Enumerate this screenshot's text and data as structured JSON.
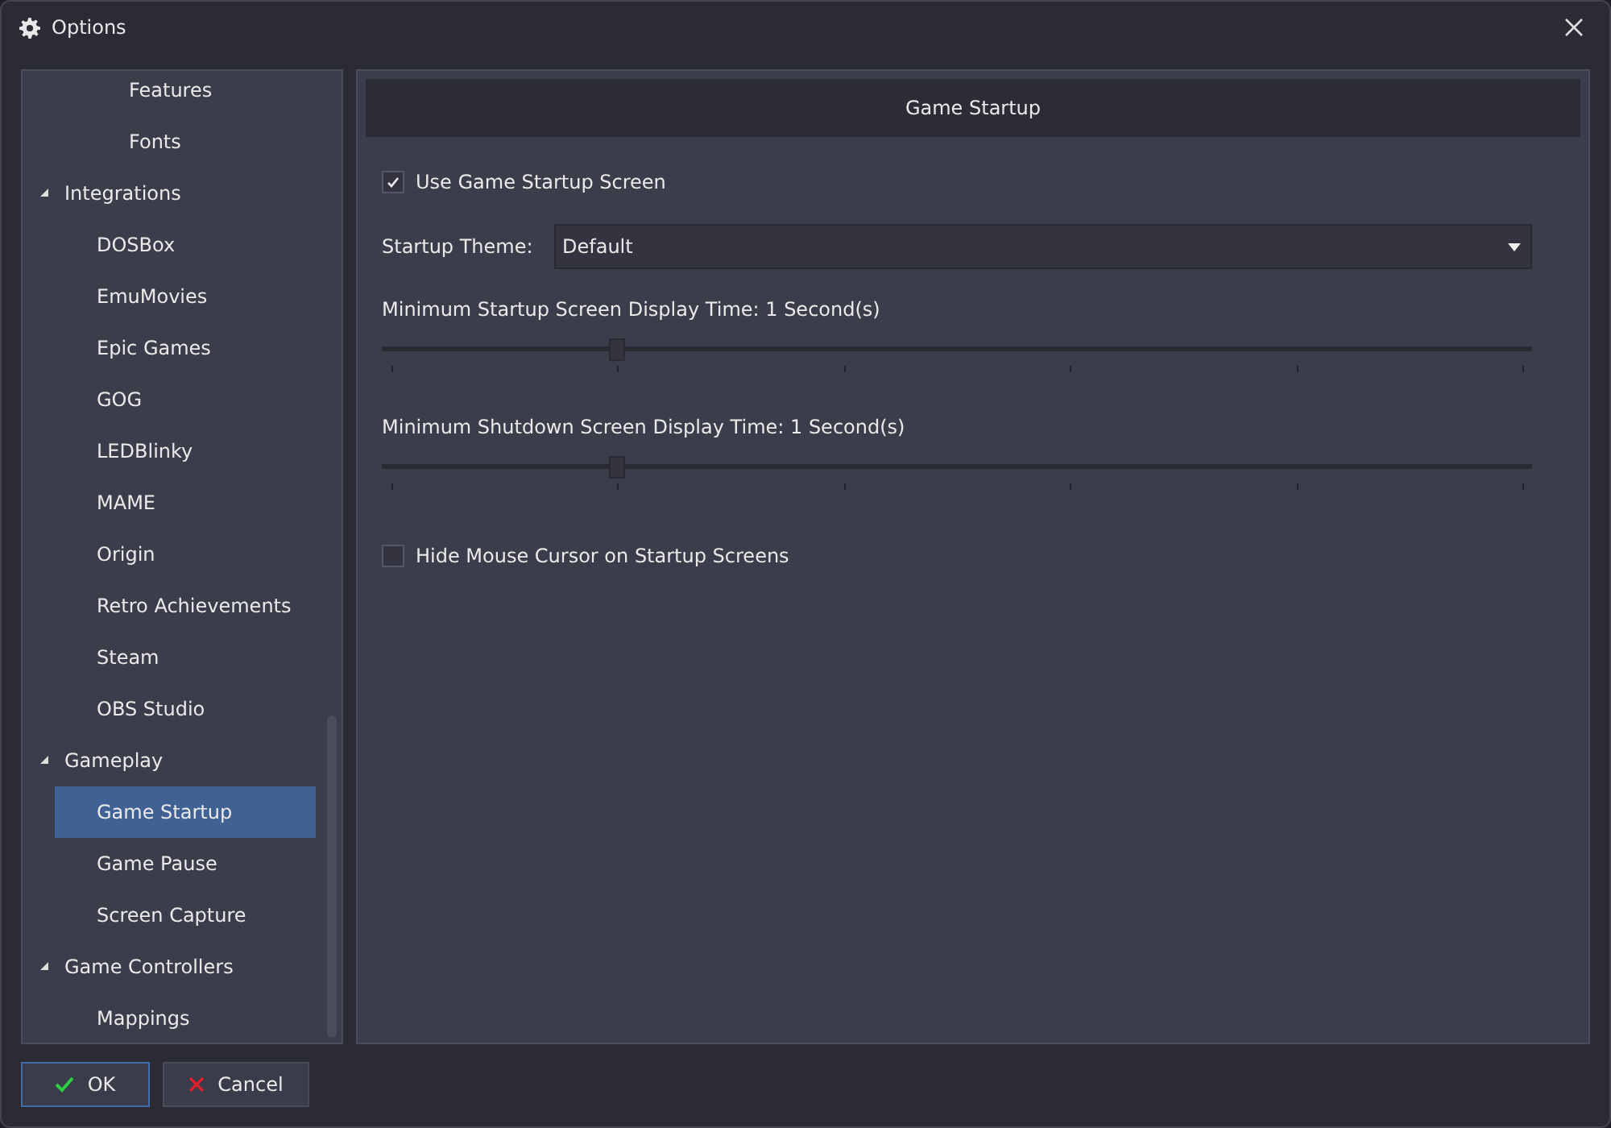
{
  "window": {
    "title": "Options"
  },
  "tree": [
    {
      "children": [
        {
          "children": [
            {
              "label": "Features",
              "selected": false
            },
            {
              "label": "Fonts",
              "selected": false
            }
          ]
        }
      ]
    },
    {
      "label": "Integrations",
      "expanded": true,
      "selected": false,
      "children": [
        {
          "label": "DOSBox",
          "selected": false
        },
        {
          "label": "EmuMovies",
          "selected": false
        },
        {
          "label": "Epic Games",
          "selected": false
        },
        {
          "label": "GOG",
          "selected": false
        },
        {
          "label": "LEDBlinky",
          "selected": false
        },
        {
          "label": "MAME",
          "selected": false
        },
        {
          "label": "Origin",
          "selected": false
        },
        {
          "label": "Retro Achievements",
          "selected": false
        },
        {
          "label": "Steam",
          "selected": false
        },
        {
          "label": "OBS Studio",
          "selected": false
        }
      ]
    },
    {
      "label": "Gameplay",
      "expanded": true,
      "selected": false,
      "children": [
        {
          "label": "Game Startup",
          "selected": true
        },
        {
          "label": "Game Pause",
          "selected": false
        },
        {
          "label": "Screen Capture",
          "selected": false
        }
      ]
    },
    {
      "label": "Game Controllers",
      "expanded": true,
      "selected": false,
      "children": [
        {
          "label": "Mappings",
          "selected": false
        }
      ]
    }
  ],
  "panel": {
    "title": "Game Startup",
    "use_startup_screen": {
      "label": "Use Game Startup Screen",
      "checked": true
    },
    "theme": {
      "label": "Startup Theme:",
      "value": "Default"
    },
    "sliders": [
      {
        "label": "Minimum Startup Screen Display Time: 1 Second(s)",
        "level": 0.2
      },
      {
        "label": "Minimum Shutdown Screen Display Time: 1 Second(s)",
        "level": 0.2
      }
    ],
    "hide_cursor": {
      "label": "Hide Mouse Cursor on Startup Screens",
      "checked": false
    }
  },
  "buttons": [
    {
      "label": "OK",
      "kind": "ok",
      "focused": true
    },
    {
      "label": "Cancel",
      "kind": "cancel",
      "focused": false
    }
  ]
}
